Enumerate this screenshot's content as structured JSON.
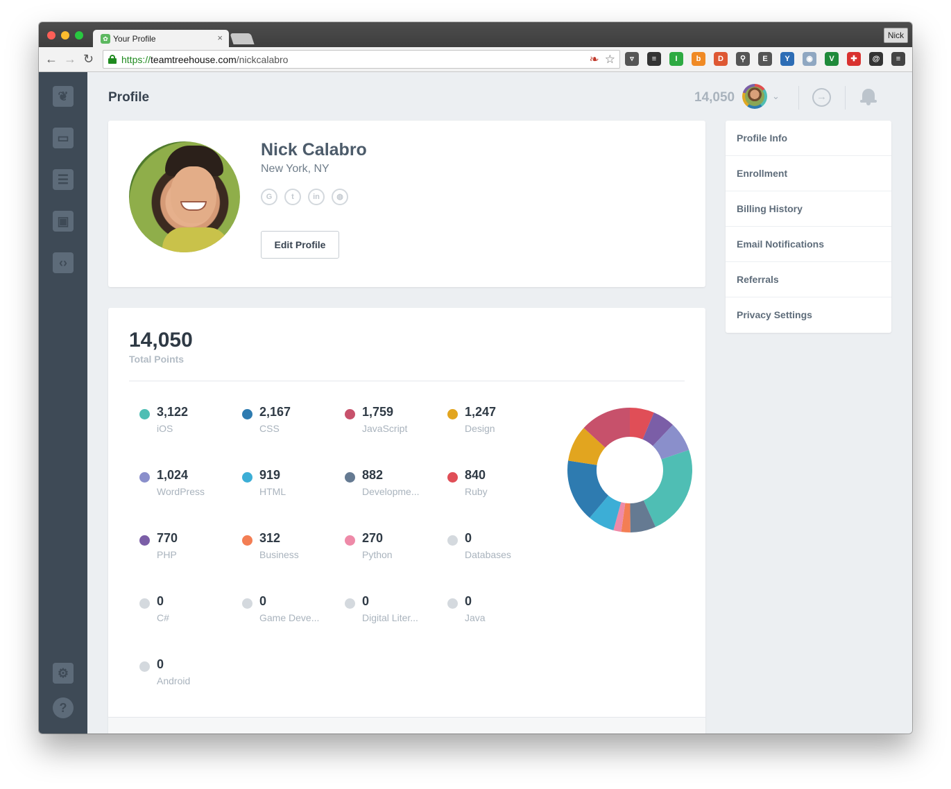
{
  "browser": {
    "tab_title": "Your Profile",
    "tab_close": "×",
    "user_button": "Nick",
    "url_scheme": "https://",
    "url_host": "teamtreehouse.com",
    "url_path": "/nickcalabro",
    "back_glyph": "←",
    "forward_glyph": "→",
    "reload_glyph": "↻",
    "star_glyph": "☆",
    "extensions": [
      {
        "name": "pocket-extension-icon",
        "color": "#555555",
        "glyph": "▿"
      },
      {
        "name": "buffer-extension-icon",
        "color": "#333333",
        "glyph": "≡"
      },
      {
        "name": "green-extension-icon",
        "color": "#2eaa42",
        "glyph": "I"
      },
      {
        "name": "orange-extension-icon",
        "color": "#f08a24",
        "glyph": "b"
      },
      {
        "name": "duckduckgo-extension-icon",
        "color": "#de5833",
        "glyph": "D"
      },
      {
        "name": "tool-extension-icon",
        "color": "#555555",
        "glyph": "⚲"
      },
      {
        "name": "evernote-extension-icon",
        "color": "#555555",
        "glyph": "E"
      },
      {
        "name": "y-extension-icon",
        "color": "#2d6db5",
        "glyph": "Y"
      },
      {
        "name": "camera-extension-icon",
        "color": "#8fa7c1",
        "glyph": "◉"
      },
      {
        "name": "v-extension-icon",
        "color": "#1f8a3a",
        "glyph": "V"
      },
      {
        "name": "puzzle-extension-icon",
        "color": "#d9322f",
        "glyph": "✚"
      },
      {
        "name": "at-extension-icon",
        "color": "#333333",
        "glyph": "@"
      },
      {
        "name": "menu-extension-icon",
        "color": "#444444",
        "glyph": "≡"
      }
    ]
  },
  "header": {
    "title": "Profile",
    "points": "14,050",
    "caret": "⌄",
    "signout_glyph": "→"
  },
  "profile": {
    "name": "Nick Calabro",
    "location": "New York, NY",
    "social": [
      {
        "name": "github-icon",
        "glyph": "G"
      },
      {
        "name": "twitter-icon",
        "glyph": "t"
      },
      {
        "name": "linkedin-icon",
        "glyph": "in"
      },
      {
        "name": "website-icon",
        "glyph": "◍"
      }
    ],
    "edit_button": "Edit Profile"
  },
  "points": {
    "total": "14,050",
    "total_label": "Total Points",
    "breakdown": [
      {
        "value": "3,122",
        "label": "iOS",
        "color": "#4fbeb4"
      },
      {
        "value": "2,167",
        "label": "CSS",
        "color": "#2e7bb0"
      },
      {
        "value": "1,759",
        "label": "JavaScript",
        "color": "#c7516b"
      },
      {
        "value": "1,247",
        "label": "Design",
        "color": "#e2a51f"
      },
      {
        "value": "1,024",
        "label": "WordPress",
        "color": "#8a8fcb"
      },
      {
        "value": "919",
        "label": "HTML",
        "color": "#3caed6"
      },
      {
        "value": "882",
        "label": "Developme...",
        "color": "#657a92"
      },
      {
        "value": "840",
        "label": "Ruby",
        "color": "#e04e57"
      },
      {
        "value": "770",
        "label": "PHP",
        "color": "#7b5ea7"
      },
      {
        "value": "312",
        "label": "Business",
        "color": "#f37e54"
      },
      {
        "value": "270",
        "label": "Python",
        "color": "#ee8aa8"
      },
      {
        "value": "0",
        "label": "Databases",
        "color": "#d4d9de"
      },
      {
        "value": "0",
        "label": "C#",
        "color": "#d4d9de"
      },
      {
        "value": "0",
        "label": "Game Deve...",
        "color": "#d4d9de"
      },
      {
        "value": "0",
        "label": "Digital Liter...",
        "color": "#d4d9de"
      },
      {
        "value": "0",
        "label": "Java",
        "color": "#d4d9de"
      },
      {
        "value": "0",
        "label": "Android",
        "color": "#d4d9de"
      }
    ]
  },
  "chart_data": {
    "type": "pie",
    "donut": true,
    "start_angle_deg": 0,
    "clockwise": true,
    "slices": [
      {
        "label": "Ruby",
        "value": 840,
        "color": "#e04e57"
      },
      {
        "label": "PHP",
        "value": 770,
        "color": "#7b5ea7"
      },
      {
        "label": "WordPress",
        "value": 1024,
        "color": "#8a8fcb"
      },
      {
        "label": "iOS",
        "value": 3122,
        "color": "#4fbeb4"
      },
      {
        "label": "Developme...",
        "value": 882,
        "color": "#657a92"
      },
      {
        "label": "Business",
        "value": 312,
        "color": "#f37e54"
      },
      {
        "label": "Python",
        "value": 270,
        "color": "#ee8aa8"
      },
      {
        "label": "HTML",
        "value": 919,
        "color": "#3caed6"
      },
      {
        "label": "CSS",
        "value": 2167,
        "color": "#2e7bb0"
      },
      {
        "label": "Design",
        "value": 1247,
        "color": "#e2a51f"
      },
      {
        "label": "JavaScript",
        "value": 1759,
        "color": "#c7516b"
      }
    ]
  },
  "menu": {
    "items": [
      "Profile Info",
      "Enrollment",
      "Billing History",
      "Email Notifications",
      "Referrals",
      "Privacy Settings"
    ]
  },
  "sidebar": {
    "icons": [
      {
        "name": "treehouse-logo-icon",
        "glyph": "❦"
      },
      {
        "name": "library-icon",
        "glyph": "▭"
      },
      {
        "name": "tracks-icon",
        "glyph": "☰"
      },
      {
        "name": "community-icon",
        "glyph": "▣"
      },
      {
        "name": "workspaces-icon",
        "glyph": "‹›"
      },
      {
        "name": "settings-icon",
        "glyph": "⚙"
      },
      {
        "name": "help-icon",
        "glyph": "?"
      }
    ]
  }
}
